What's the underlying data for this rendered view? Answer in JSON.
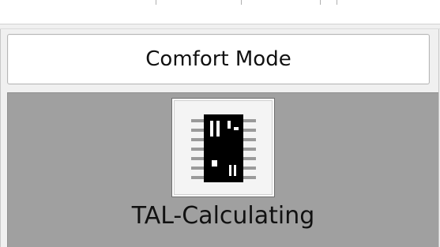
{
  "mode_button": {
    "label": "Comfort Mode"
  },
  "function_tile": {
    "label": "TAL-Calculating",
    "icon": "chip-icon"
  }
}
